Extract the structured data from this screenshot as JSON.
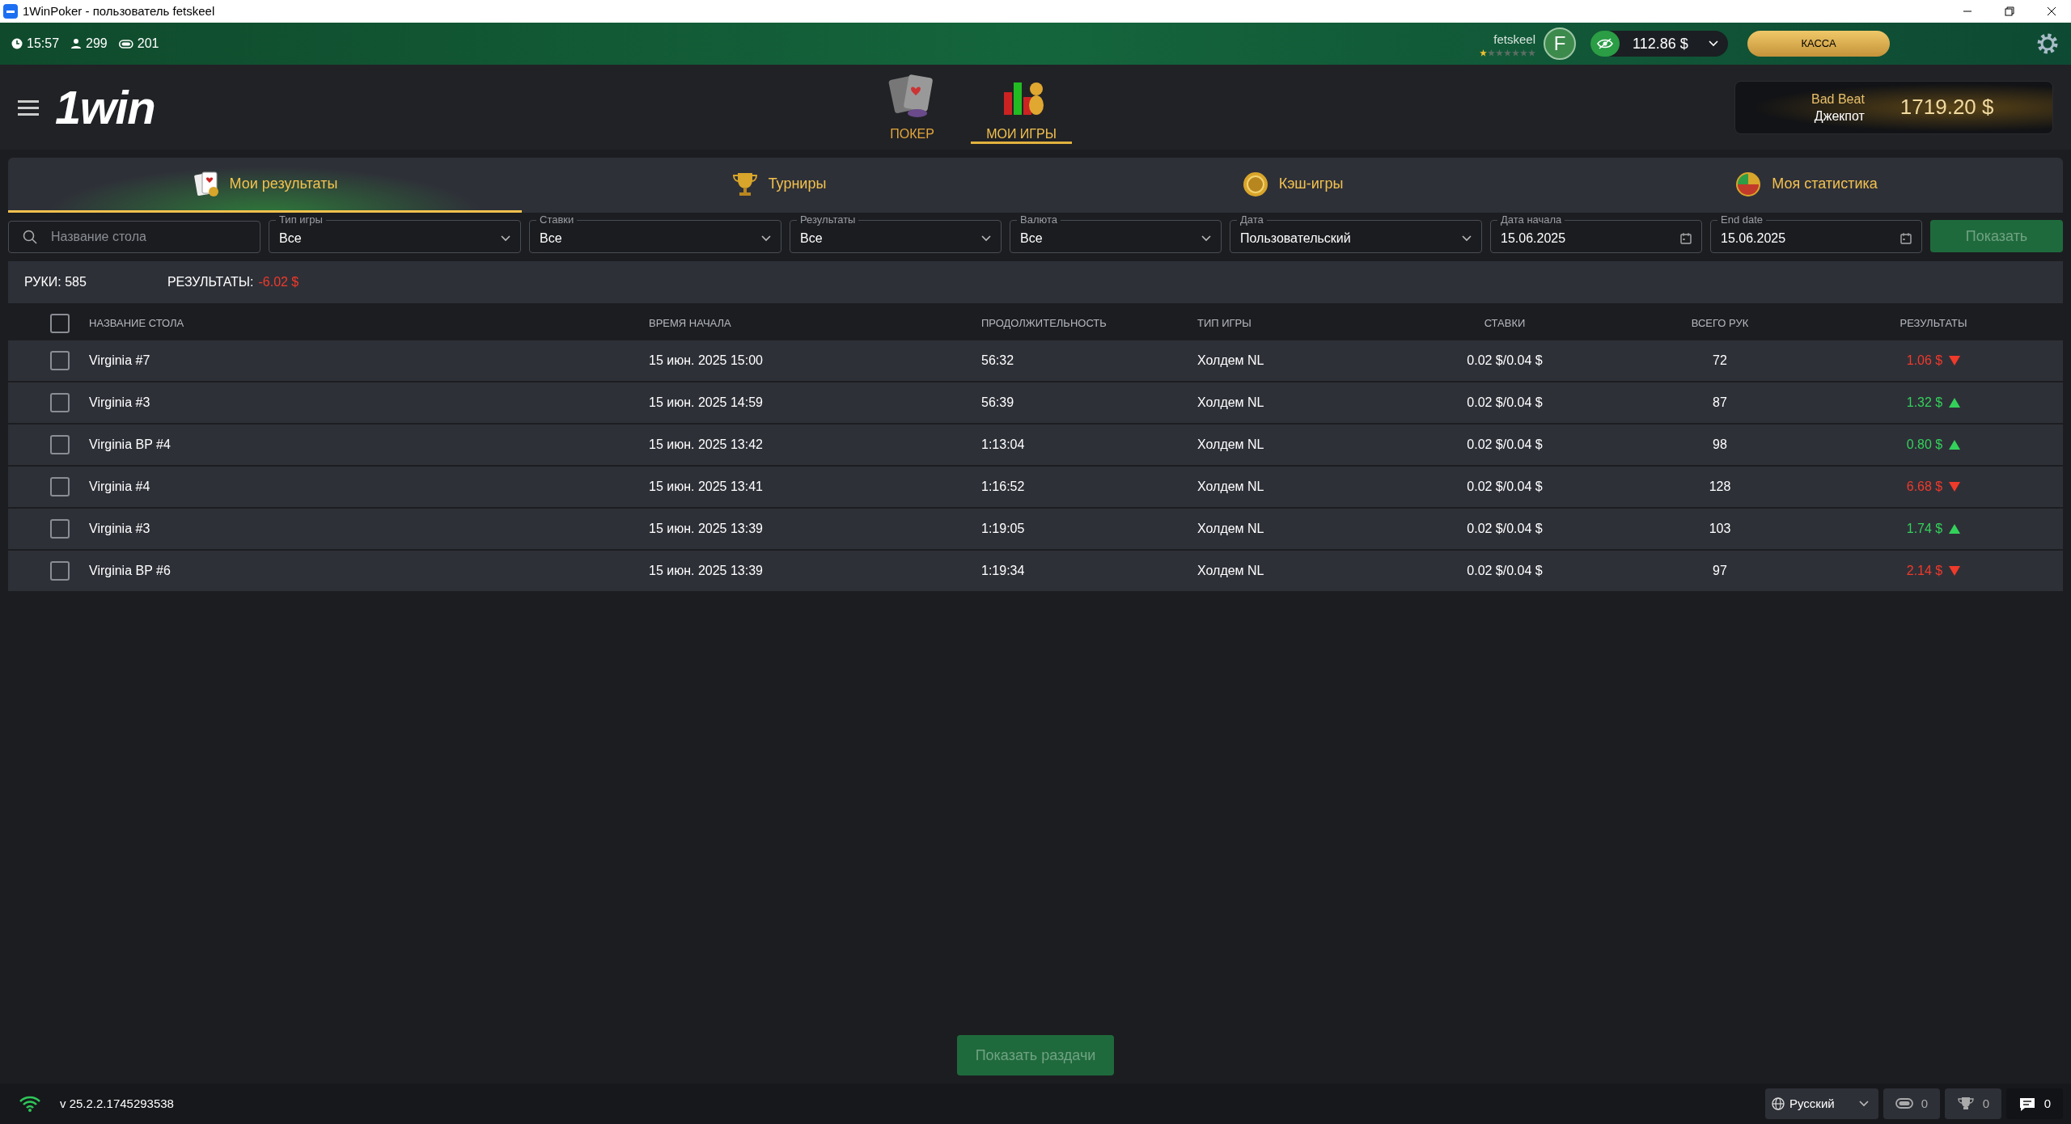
{
  "window": {
    "title": "1WinPoker - пользователь fetskeel"
  },
  "top_bar": {
    "stats": [
      {
        "kind": "clock",
        "text": "15:57"
      },
      {
        "kind": "players",
        "text": "299"
      },
      {
        "kind": "tables",
        "text": "201"
      }
    ],
    "user": {
      "name": "fetskeel",
      "avatar_letter": "F",
      "stars": 1
    },
    "balance": "112.86 $",
    "cashier_button": "КАССА"
  },
  "header": {
    "logo": "1win",
    "nav": [
      {
        "label": "ПОКЕР",
        "selected": false
      },
      {
        "label": "МОИ ИГРЫ",
        "selected": true
      }
    ],
    "jackpot": {
      "title": "Bad Beat",
      "subtitle": "Джекпот",
      "amount": "1719.20 $"
    }
  },
  "tabs": [
    {
      "label": "Мои результаты",
      "selected": true
    },
    {
      "label": "Турниры",
      "selected": false
    },
    {
      "label": "Кэш-игры",
      "selected": false
    },
    {
      "label": "Моя статистика",
      "selected": false
    }
  ],
  "filters": [
    {
      "kind": "search",
      "placeholder": "Название стола"
    },
    {
      "kind": "select",
      "label": "Тип игры",
      "value": "Все"
    },
    {
      "kind": "select",
      "label": "Ставки",
      "value": "Все"
    },
    {
      "kind": "select",
      "label": "Результаты",
      "value": "Все"
    },
    {
      "kind": "select",
      "label": "Валюта",
      "value": "Все"
    },
    {
      "kind": "select",
      "label": "Дата",
      "value": "Пользовательский"
    },
    {
      "kind": "date",
      "label": "Дата начала",
      "value": "15.06.2025"
    },
    {
      "kind": "date",
      "label": "End date",
      "value": "15.06.2025"
    }
  ],
  "show_button": {
    "label": "Показать",
    "disabled": true
  },
  "summary": {
    "hands_label": "РУКИ: 585",
    "results_label": "РЕЗУЛЬТАТЫ:",
    "results_value": "-6.02 $"
  },
  "table": {
    "select_all_checked": false,
    "columns": [
      "НАЗВАНИЕ СТОЛА",
      "ВРЕМЯ НАЧАЛА",
      "ПРОДОЛЖИТЕЛЬНОСТЬ",
      "ТИП ИГРЫ",
      "СТАВКИ",
      "ВСЕГО РУК",
      "РЕЗУЛЬТАТЫ"
    ],
    "rows": [
      {
        "checked": false,
        "cells": [
          "Virginia #7",
          "15 июн. 2025 15:00",
          "56:32",
          "Холдем NL",
          "0.02 $/0.04 $",
          "72",
          "1.06 $"
        ],
        "rising": false
      },
      {
        "checked": false,
        "cells": [
          "Virginia #3",
          "15 июн. 2025 14:59",
          "56:39",
          "Холдем NL",
          "0.02 $/0.04 $",
          "87",
          "1.32 $"
        ],
        "rising": true
      },
      {
        "checked": false,
        "cells": [
          "Virginia BP #4",
          "15 июн. 2025 13:42",
          "1:13:04",
          "Холдем NL",
          "0.02 $/0.04 $",
          "98",
          "0.80 $"
        ],
        "rising": true
      },
      {
        "checked": false,
        "cells": [
          "Virginia #4",
          "15 июн. 2025 13:41",
          "1:16:52",
          "Холдем NL",
          "0.02 $/0.04 $",
          "128",
          "6.68 $"
        ],
        "rising": false
      },
      {
        "checked": false,
        "cells": [
          "Virginia #3",
          "15 июн. 2025 13:39",
          "1:19:05",
          "Холдем NL",
          "0.02 $/0.04 $",
          "103",
          "1.74 $"
        ],
        "rising": true
      },
      {
        "checked": false,
        "cells": [
          "Virginia BP #6",
          "15 июн. 2025 13:39",
          "1:19:34",
          "Холдем NL",
          "0.02 $/0.04 $",
          "97",
          "2.14 $"
        ],
        "rising": false
      }
    ]
  },
  "show_hands_button": {
    "label": "Показать раздачи",
    "disabled": true
  },
  "status_bar": {
    "version": "v 25.2.2.1745293538",
    "language": "Русский",
    "counters": [
      {
        "kind": "tables",
        "text": "0"
      },
      {
        "kind": "trophy",
        "text": "0"
      },
      {
        "kind": "chat",
        "text": "0"
      }
    ]
  }
}
